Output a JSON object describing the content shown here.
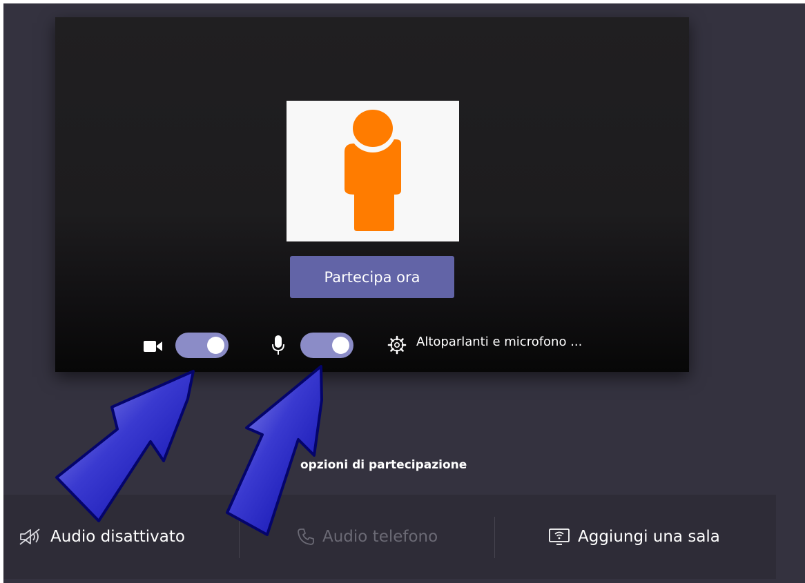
{
  "preview": {
    "join_button": "Partecipa ora",
    "camera_on": true,
    "mic_on": true,
    "devices_label": "Altoparlanti e microfono ..."
  },
  "options": {
    "heading": "opzioni di partecipazione",
    "items": [
      {
        "label": "Audio disattivato",
        "icon": "speaker-muted-icon",
        "enabled": true
      },
      {
        "label": "Audio telefono",
        "icon": "phone-icon",
        "enabled": false
      },
      {
        "label": "Aggiungi una sala",
        "icon": "room-display-icon",
        "enabled": true
      }
    ]
  },
  "colors": {
    "background": "#34323f",
    "video_panel": "#1d1c1e",
    "accent": "#6264a7",
    "toggle_on": "#8b8cc7",
    "avatar": "#ff7c00",
    "annotation_arrow": "#0a0aa8"
  }
}
